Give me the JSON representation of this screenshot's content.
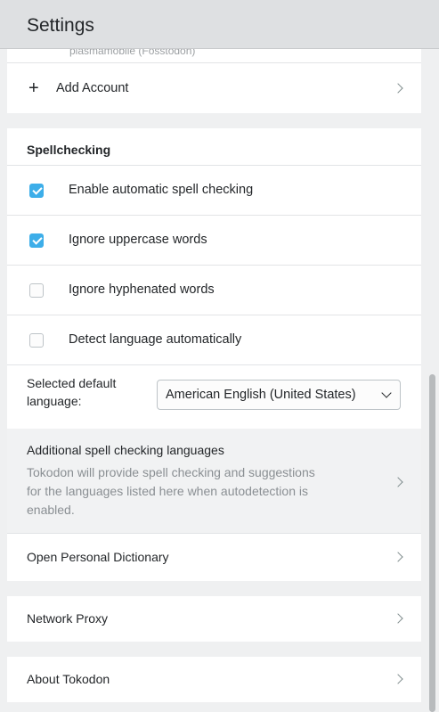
{
  "header": {
    "title": "Settings"
  },
  "accounts": {
    "partial_account": "plasmamobile (Fosstodon)",
    "add_account": "Add Account"
  },
  "spellchecking": {
    "title": "Spellchecking",
    "options": [
      {
        "label": "Enable automatic spell checking",
        "checked": true
      },
      {
        "label": "Ignore uppercase words",
        "checked": true
      },
      {
        "label": "Ignore hyphenated words",
        "checked": false
      },
      {
        "label": "Detect language automatically",
        "checked": false
      }
    ],
    "default_language_label_line1": "Selected default",
    "default_language_label_line2": "language:",
    "default_language_value": "American English (United States)",
    "additional": {
      "title": "Additional spell checking languages",
      "description_line1": "Tokodon will provide spell checking and suggestions",
      "description_line2": "for the languages listed here when autodetection is",
      "description_line3": "enabled."
    },
    "open_dictionary": "Open Personal Dictionary"
  },
  "network_proxy": "Network Proxy",
  "about": "About Tokodon",
  "colors": {
    "accent": "#3daee9",
    "background": "#eff0f1",
    "card": "#ffffff",
    "header": "#dee0e2"
  }
}
